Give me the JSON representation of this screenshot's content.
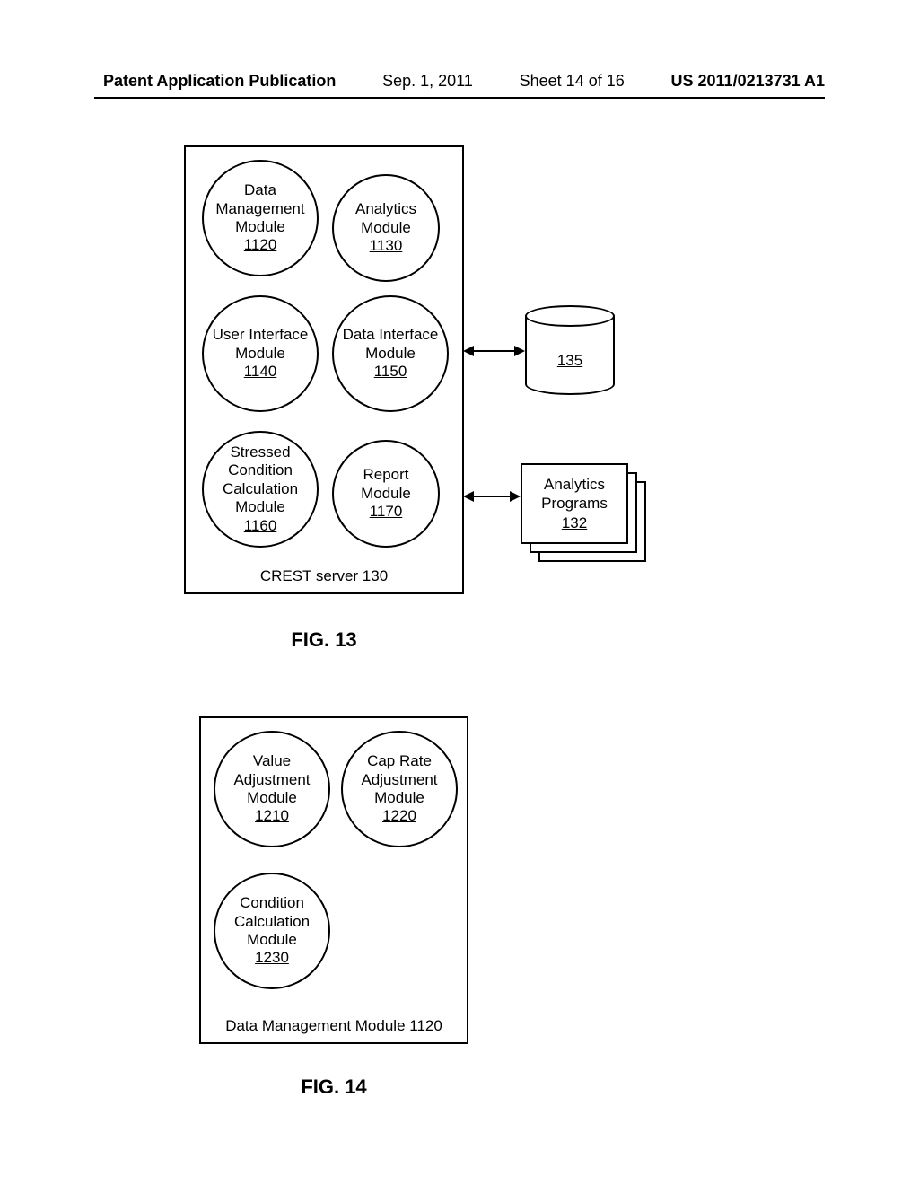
{
  "header": {
    "publication": "Patent Application Publication",
    "date": "Sep. 1, 2011",
    "sheet": "Sheet 14 of 16",
    "number": "US 2011/0213731 A1"
  },
  "fig13": {
    "caption": "FIG. 13",
    "server_label": "CREST server 130",
    "modules": {
      "m1": {
        "l1": "Data",
        "l2": "Management",
        "l3": "Module",
        "ref": "1120"
      },
      "m2": {
        "l1": "Analytics",
        "l2": "Module",
        "l3": "",
        "ref": "1130"
      },
      "m3": {
        "l1": "User Interface",
        "l2": "Module",
        "l3": "",
        "ref": "1140"
      },
      "m4": {
        "l1": "Data Interface",
        "l2": "Module",
        "l3": "",
        "ref": "1150"
      },
      "m5": {
        "l1": "Stressed",
        "l2": "Condition",
        "l3": "Calculation",
        "l4": "Module",
        "ref": "1160"
      },
      "m6": {
        "l1": "Report",
        "l2": "Module",
        "l3": "",
        "ref": "1170"
      }
    },
    "db_ref": "135",
    "programs": {
      "l1": "Analytics",
      "l2": "Programs",
      "ref": "132"
    }
  },
  "fig14": {
    "caption": "FIG. 14",
    "box_label": "Data Management Module 1120",
    "modules": {
      "d1": {
        "l1": "Value",
        "l2": "Adjustment",
        "l3": "Module",
        "ref": "1210"
      },
      "d2": {
        "l1": "Cap Rate",
        "l2": "Adjustment",
        "l3": "Module",
        "ref": "1220"
      },
      "d3": {
        "l1": "Condition",
        "l2": "Calculation",
        "l3": "Module",
        "ref": "1230"
      }
    }
  }
}
